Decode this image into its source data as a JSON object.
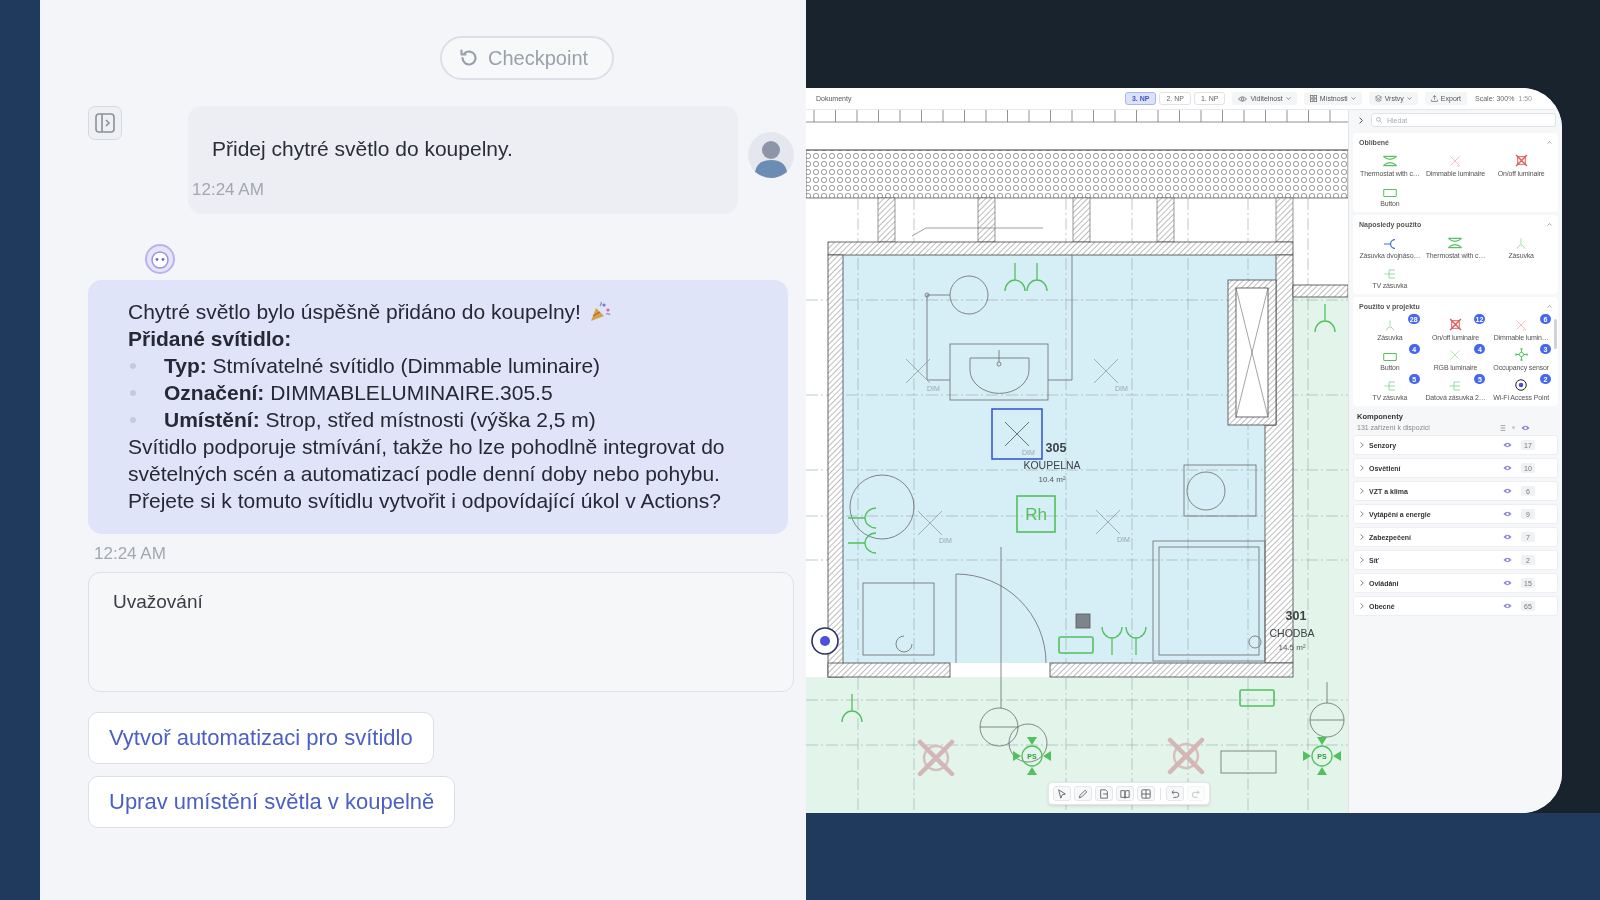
{
  "chat": {
    "checkpoint": "Checkpoint",
    "user_message": {
      "text": "Přidej chytré světlo do koupelny.",
      "time": "12:24 AM"
    },
    "assistant_message": {
      "title": "Chytré světlo bylo úspěšně přidáno do koupelny!",
      "heading": "Přidané svítidlo:",
      "items": [
        "**Typ:** Stmívatelné svítidlo (Dimmable luminaire)",
        "**Označení:** DIMMABLELUMINAIRE.305.5",
        "**Umístění:** Strop, střed místnosti (výška 2,5 m)"
      ],
      "paragraph": "Svítidlo podporuje stmívání, takže ho lze pohodlně integrovat do světelných scén a automatizací podle denní doby nebo pohybu. Přejete si k tomuto svítidlu vytvořit i odpovídající úkol v Actions?",
      "time": "12:24 AM"
    },
    "reasoning": "Uvažování",
    "suggestions": [
      "Vytvoř automatizaci pro svítidlo",
      "Uprav umístění světla v koupelně"
    ]
  },
  "editor": {
    "toolbar": {
      "title": "Dokumenty",
      "floors": [
        {
          "label": "3. NP",
          "selected": true
        },
        {
          "label": "2. NP",
          "selected": false
        },
        {
          "label": "1. NP",
          "selected": false
        }
      ],
      "menus": [
        {
          "kind": "visibility",
          "label": "Viditelnost"
        },
        {
          "kind": "rooms",
          "label": "Místnosti"
        },
        {
          "kind": "layers",
          "label": "Vrstvy"
        }
      ],
      "export": "Export",
      "scale": "Scale: 300%",
      "ratio": "1:50"
    },
    "plan": {
      "rooms": [
        {
          "number": "305",
          "name": "KOUPELNA",
          "area": "10.4 m²"
        },
        {
          "number": "301",
          "name": "CHODBA",
          "area": "14.5 m²"
        }
      ],
      "devices": [
        {
          "kind": "socket",
          "selected": false
        },
        {
          "kind": "socket",
          "selected": false
        },
        {
          "kind": "socket",
          "selected": false
        },
        {
          "kind": "dimmable",
          "label": "DIM",
          "selected": false
        },
        {
          "kind": "dimmable",
          "label": "DIM",
          "selected": false
        },
        {
          "kind": "dimmable",
          "label": "DIM",
          "selected": true
        },
        {
          "kind": "socket",
          "selected": false
        },
        {
          "kind": "thermostat",
          "label": "Rh",
          "selected": false
        },
        {
          "kind": "dimmable",
          "label": "DIM",
          "selected": false
        },
        {
          "kind": "dimmable",
          "label": "DIM",
          "selected": false
        },
        {
          "kind": "socket",
          "selected": false
        },
        {
          "kind": "module",
          "selected": false
        },
        {
          "kind": "socket",
          "selected": false
        },
        {
          "kind": "socket",
          "selected": false
        },
        {
          "kind": "accesspoint",
          "selected": false
        },
        {
          "kind": "button",
          "selected": false
        },
        {
          "kind": "button",
          "selected": false
        },
        {
          "kind": "socket",
          "selected": false
        },
        {
          "kind": "onoff",
          "selected": false
        },
        {
          "kind": "sensor",
          "label": "PS",
          "selected": false
        },
        {
          "kind": "onoff",
          "selected": false
        },
        {
          "kind": "sensor",
          "label": "PS",
          "selected": false
        }
      ]
    },
    "tools": [
      {
        "kind": "select",
        "disabled": false
      },
      {
        "kind": "draw",
        "disabled": false
      },
      {
        "kind": "note",
        "disabled": false
      },
      {
        "kind": "book",
        "disabled": false
      },
      {
        "kind": "grid",
        "disabled": false
      },
      {
        "kind": "undo",
        "disabled": false
      },
      {
        "kind": "redo",
        "disabled": true
      }
    ],
    "sidebar": {
      "search_placeholder": "Hledat",
      "sections": [
        {
          "title": "Oblíbené",
          "expanded": true,
          "items": [
            {
              "kind": "thermostat",
              "label": "Thermostat with c…"
            },
            {
              "kind": "dimmable",
              "label": "Dimmable luminaire"
            },
            {
              "kind": "onoff",
              "label": "On/off luminaire"
            },
            {
              "kind": "button",
              "label": "Button"
            }
          ]
        },
        {
          "title": "Naposledy použito",
          "expanded": true,
          "items": [
            {
              "kind": "doublesocket",
              "label": "Zásuvka dvojnáso…"
            },
            {
              "kind": "thermostat",
              "label": "Thermostat with c…"
            },
            {
              "kind": "socket",
              "label": "Zásuvka"
            },
            {
              "kind": "tvsocket",
              "label": "TV zásuvka"
            }
          ]
        },
        {
          "title": "Použito v projektu",
          "expanded": true,
          "items": [
            {
              "kind": "socket",
              "label": "Zásuvka",
              "count": "28"
            },
            {
              "kind": "onoff",
              "label": "On/off luminaire",
              "count": "12"
            },
            {
              "kind": "dimmable",
              "label": "Dimmable lumin…",
              "count": "6"
            },
            {
              "kind": "button",
              "label": "Button",
              "count": "4"
            },
            {
              "kind": "rgb",
              "label": "RGB luminaire",
              "count": "4"
            },
            {
              "kind": "occupancy",
              "label": "Occupancy sensor",
              "count": "3"
            },
            {
              "kind": "tvsocket",
              "label": "TV zásuvka",
              "count": "5"
            },
            {
              "kind": "datasocket",
              "label": "Datová zásuvka 2…",
              "count": "5"
            },
            {
              "kind": "accesspoint",
              "label": "Wi-Fi Access Point",
              "count": "2"
            }
          ]
        }
      ],
      "components": {
        "title": "Komponenty",
        "subtitle": "131 zařízení k dispozici",
        "categories": [
          {
            "label": "Senzory",
            "count": "17",
            "expanded": false,
            "visible": true
          },
          {
            "label": "Osvětlení",
            "count": "10",
            "expanded": false,
            "visible": true
          },
          {
            "label": "VZT a klima",
            "count": "6",
            "expanded": false,
            "visible": true
          },
          {
            "label": "Vytápění a energie",
            "count": "9",
            "expanded": false,
            "visible": true
          },
          {
            "label": "Zabezpečení",
            "count": "7",
            "expanded": false,
            "visible": true
          },
          {
            "label": "Síť",
            "count": "2",
            "expanded": false,
            "visible": true
          },
          {
            "label": "Ovládání",
            "count": "15",
            "expanded": false,
            "visible": true
          },
          {
            "label": "Obecné",
            "count": "65",
            "expanded": false,
            "visible": true
          }
        ]
      }
    }
  }
}
